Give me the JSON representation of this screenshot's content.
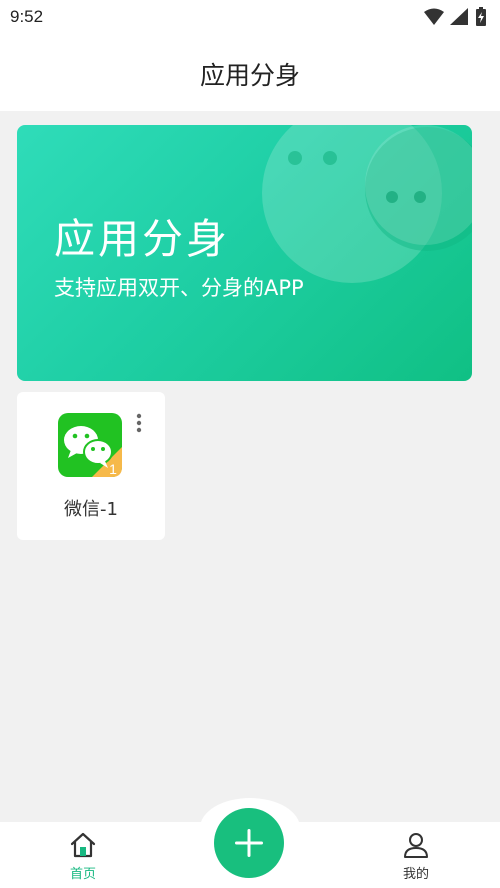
{
  "status_bar": {
    "time": "9:52",
    "icons": [
      "wifi-icon",
      "signal-icon",
      "battery-icon"
    ]
  },
  "header": {
    "title": "应用分身"
  },
  "banner": {
    "title": "应用分身",
    "subtitle": "支持应用双开、分身的APP"
  },
  "apps": [
    {
      "name": "微信-1",
      "icon": "wechat-icon",
      "badge": "1"
    }
  ],
  "bottom_nav": {
    "items": [
      {
        "label": "首页",
        "icon": "home-icon",
        "active": true
      },
      {
        "label": "我的",
        "icon": "person-icon",
        "active": false
      }
    ],
    "fab_icon": "plus-icon"
  },
  "colors": {
    "accent": "#18bf7e",
    "banner_start": "#2fdcb9",
    "banner_end": "#10c084",
    "background": "#f1f1f1"
  }
}
